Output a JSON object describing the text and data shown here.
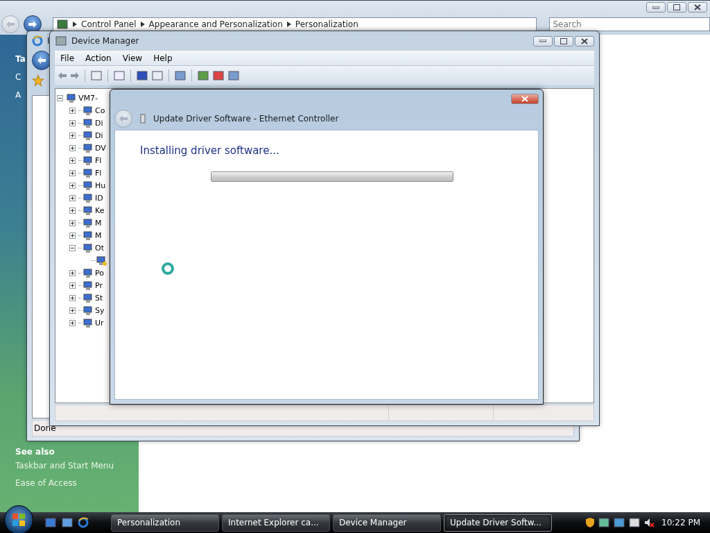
{
  "control_panel": {
    "breadcrumbs": [
      "Control Panel",
      "Appearance and Personalization",
      "Personalization"
    ],
    "search": {
      "placeholder": "Search"
    },
    "sidebar": {
      "items": [
        "Ta",
        "C",
        "A"
      ],
      "see_also": {
        "title": "See also",
        "links": [
          "Taskbar and Start Menu",
          "Ease of Access"
        ]
      }
    }
  },
  "ie_window": {
    "title": "I",
    "status": "Done"
  },
  "device_manager": {
    "title": "Device Manager",
    "menu": [
      "File",
      "Action",
      "View",
      "Help"
    ],
    "tree": {
      "label": "VM7-",
      "expanded": true,
      "children": [
        {
          "label": "Co",
          "expanded": false
        },
        {
          "label": "Di",
          "expanded": false
        },
        {
          "label": "Di",
          "expanded": false
        },
        {
          "label": "DV",
          "expanded": false
        },
        {
          "label": "Fl",
          "expanded": false
        },
        {
          "label": "Fl",
          "expanded": false
        },
        {
          "label": "Hu",
          "expanded": false
        },
        {
          "label": "ID",
          "expanded": false
        },
        {
          "label": "Ke",
          "expanded": false
        },
        {
          "label": "M",
          "expanded": false
        },
        {
          "label": "M",
          "expanded": false
        },
        {
          "label": "Ot",
          "expanded": true,
          "children": [
            {
              "kind": "warning-device"
            }
          ]
        },
        {
          "label": "Po",
          "expanded": false
        },
        {
          "label": "Pr",
          "expanded": false
        },
        {
          "label": "St",
          "expanded": false
        },
        {
          "label": "Sy",
          "expanded": false
        },
        {
          "label": "Ur",
          "expanded": false
        }
      ]
    }
  },
  "dialog": {
    "title": "Update Driver Software - Ethernet Controller",
    "heading": "Installing driver software...",
    "progress": {
      "level": 1
    }
  },
  "taskbar": {
    "buttons": [
      {
        "label": "Personalization",
        "selected": false
      },
      {
        "label": "Internet Explorer ca...",
        "selected": false
      },
      {
        "label": "Device Manager",
        "selected": false
      },
      {
        "label": "Update Driver Softw...",
        "selected": true
      }
    ],
    "clock": "10:22 PM"
  }
}
